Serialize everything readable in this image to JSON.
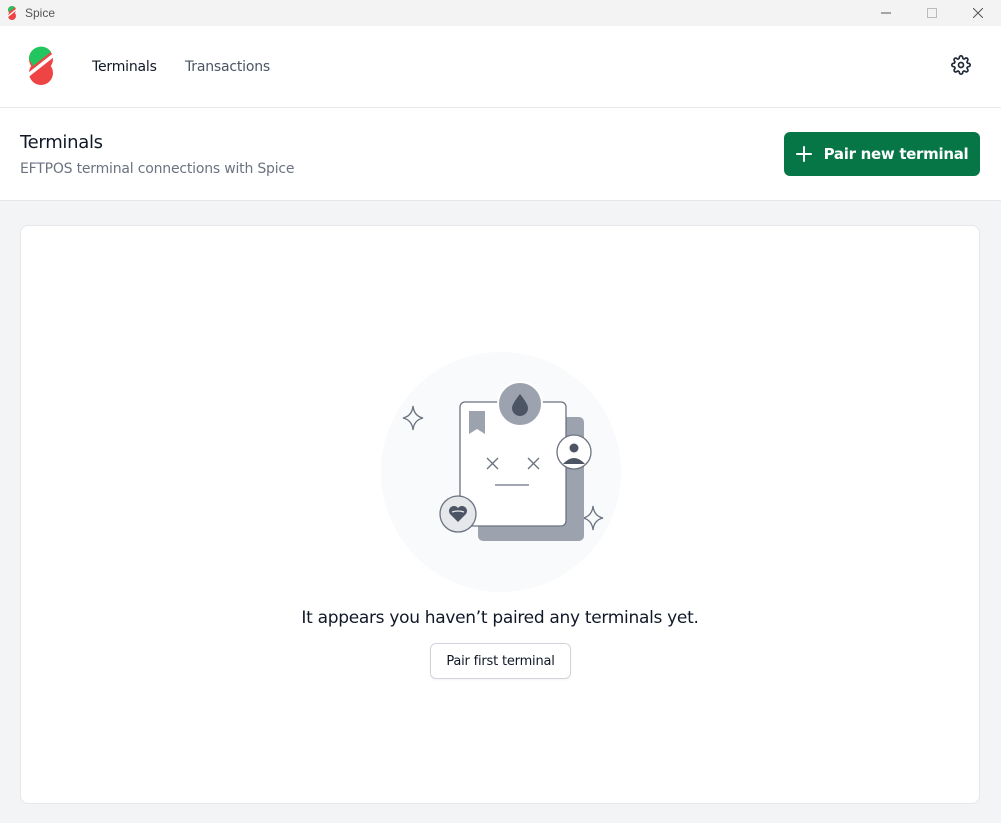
{
  "window": {
    "title": "Spice",
    "controls": [
      "minimize",
      "maximize",
      "close"
    ]
  },
  "nav": {
    "items": [
      {
        "label": "Terminals",
        "active": true
      },
      {
        "label": "Transactions",
        "active": false
      }
    ],
    "settings_icon": "gear-icon"
  },
  "page": {
    "title": "Terminals",
    "subtitle": "EFTPOS terminal connections with Spice",
    "primary_action": "Pair new terminal"
  },
  "empty_state": {
    "message": "It appears you haven’t paired any terminals yet.",
    "action": "Pair first terminal"
  },
  "colors": {
    "brand_green": "#067647",
    "logo_red": "#ef4444",
    "logo_green": "#22c55e"
  }
}
